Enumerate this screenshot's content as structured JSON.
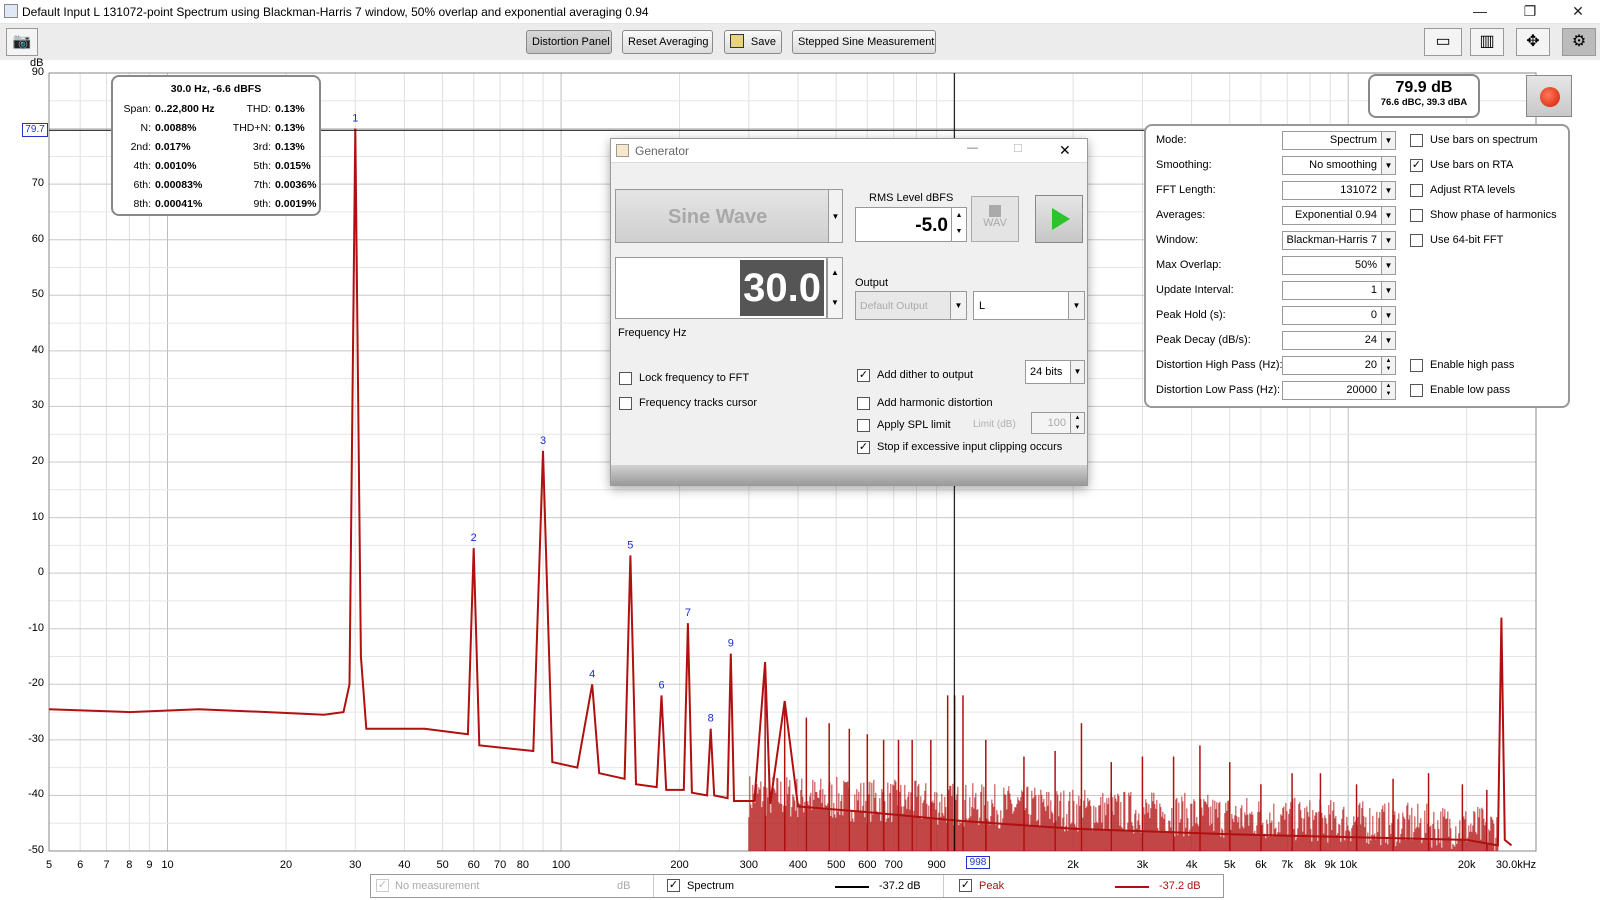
{
  "window": {
    "title": "Default Input L 131072-point Spectrum using Blackman-Harris 7 window, 50% overlap and exponential averaging 0.94"
  },
  "toolbar": {
    "distortion_panel": "Distortion Panel",
    "reset_averaging": "Reset Averaging",
    "save": "Save",
    "stepped_sine": "Stepped Sine Measurement"
  },
  "stats": {
    "header": "30.0 Hz, -6.6 dBFS",
    "rows": [
      [
        "Span:",
        "0..22,800 Hz",
        "THD:",
        "0.13%"
      ],
      [
        "N:",
        "0.0088%",
        "THD+N:",
        "0.13%"
      ],
      [
        "2nd:",
        "0.017%",
        "3rd:",
        "0.13%"
      ],
      [
        "4th:",
        "0.0010%",
        "5th:",
        "0.015%"
      ],
      [
        "6th:",
        "0.00083%",
        "7th:",
        "0.0036%"
      ],
      [
        "8th:",
        "0.00041%",
        "9th:",
        "0.0019%"
      ]
    ]
  },
  "level": {
    "main": "79.9 dB",
    "sub": "76.6 dBC, 39.3 dBA"
  },
  "cursor": {
    "y_label": "79.7",
    "x_label": "998"
  },
  "generator": {
    "title": "Generator",
    "waveform": "Sine Wave",
    "rms_label": "RMS Level dBFS",
    "rms_value": "-5.0",
    "wav_label": "WAV",
    "frequency_value": "30.0",
    "frequency_label": "Frequency Hz",
    "output_label": "Output",
    "output_device": "Default Output",
    "output_channel": "L",
    "lock_frequency": "Lock frequency to FFT",
    "tracks_cursor": "Frequency tracks cursor",
    "add_dither": "Add dither to output",
    "dither_bits": "24 bits",
    "add_harmonic": "Add harmonic distortion",
    "apply_spl": "Apply SPL limit",
    "limit_label": "Limit (dB)",
    "limit_value": "100",
    "stop_clipping": "Stop if excessive input clipping occurs"
  },
  "settings": {
    "rows": [
      {
        "label": "Mode:",
        "value": "Spectrum",
        "kind": "dd"
      },
      {
        "label": "Smoothing:",
        "value": "No  smoothing",
        "kind": "dd"
      },
      {
        "label": "FFT Length:",
        "value": "131072",
        "kind": "dd"
      },
      {
        "label": "Averages:",
        "value": "Exponential 0.94",
        "kind": "dd"
      },
      {
        "label": "Window:",
        "value": "Blackman-Harris 7",
        "kind": "dd"
      },
      {
        "label": "Max Overlap:",
        "value": "50%",
        "kind": "dd"
      },
      {
        "label": "Update Interval:",
        "value": "1",
        "kind": "dd"
      },
      {
        "label": "Peak Hold (s):",
        "value": "0",
        "kind": "dd"
      },
      {
        "label": "Peak Decay (dB/s):",
        "value": "24",
        "kind": "dd"
      },
      {
        "label": "Distortion High Pass (Hz):",
        "value": "20",
        "kind": "spin"
      },
      {
        "label": "Distortion Low Pass (Hz):",
        "value": "20000",
        "kind": "spin"
      }
    ],
    "checks": [
      {
        "label": "Use bars on spectrum",
        "checked": false,
        "row": 0
      },
      {
        "label": "Use bars on RTA",
        "checked": true,
        "row": 1
      },
      {
        "label": "Adjust RTA levels",
        "checked": false,
        "row": 2
      },
      {
        "label": "Show phase of harmonics",
        "checked": false,
        "row": 3
      },
      {
        "label": "Use 64-bit FFT",
        "checked": false,
        "row": 4
      },
      {
        "label": "Enable high pass",
        "checked": false,
        "row": 9
      },
      {
        "label": "Enable low pass",
        "checked": false,
        "row": 10
      }
    ]
  },
  "legend": {
    "no_measurement": "No measurement",
    "db_unit": "dB",
    "spectrum": "Spectrum",
    "spectrum_value": "-37.2 dB",
    "peak": "Peak",
    "peak_value": "-37.2 dB"
  },
  "chart_data": {
    "type": "line",
    "ylabel": "dB",
    "ylim": [
      -50,
      90
    ],
    "xscale": "log",
    "xlim": [
      5,
      30000
    ],
    "y_ticks": [
      "90",
      "70",
      "60",
      "50",
      "40",
      "30",
      "20",
      "10",
      "0",
      "-10",
      "-20",
      "-30",
      "-40",
      "-50"
    ],
    "x_ticks": [
      "5",
      "6",
      "7",
      "8",
      "9",
      "10",
      "20",
      "30",
      "40",
      "50",
      "60",
      "70",
      "80",
      "100",
      "200",
      "300",
      "400",
      "500",
      "600",
      "700",
      "900",
      "2k",
      "3k",
      "4k",
      "5k",
      "6k",
      "7k",
      "8k",
      "9k",
      "10k",
      "20k",
      "30.0kHz"
    ],
    "harmonic_markers": [
      {
        "label": "1",
        "freq": 30,
        "db": 80
      },
      {
        "label": "2",
        "freq": 60,
        "db": 4.5
      },
      {
        "label": "3",
        "freq": 90,
        "db": 22
      },
      {
        "label": "4",
        "freq": 120,
        "db": -20
      },
      {
        "label": "5",
        "freq": 150,
        "db": 3.2
      },
      {
        "label": "6",
        "freq": 180,
        "db": -22
      },
      {
        "label": "7",
        "freq": 210,
        "db": -9
      },
      {
        "label": "8",
        "freq": 240,
        "db": -28
      },
      {
        "label": "9",
        "freq": 270,
        "db": -14.5
      }
    ],
    "series": [
      {
        "name": "Spectrum",
        "color": "#000000"
      },
      {
        "name": "Peak",
        "color": "#b01010"
      }
    ],
    "line_points": [
      [
        5,
        -24.5
      ],
      [
        8,
        -25
      ],
      [
        12,
        -24.5
      ],
      [
        18,
        -25
      ],
      [
        25,
        -25.5
      ],
      [
        28,
        -25
      ],
      [
        29,
        -20
      ],
      [
        30,
        80
      ],
      [
        31,
        -15
      ],
      [
        32,
        -28
      ],
      [
        45,
        -28
      ],
      [
        58,
        -29
      ],
      [
        60,
        4.5
      ],
      [
        62,
        -31
      ],
      [
        85,
        -32
      ],
      [
        90,
        22
      ],
      [
        95,
        -34
      ],
      [
        110,
        -35
      ],
      [
        120,
        -20
      ],
      [
        125,
        -36
      ],
      [
        145,
        -37
      ],
      [
        150,
        3.2
      ],
      [
        155,
        -38
      ],
      [
        175,
        -38.5
      ],
      [
        180,
        -22
      ],
      [
        185,
        -39
      ],
      [
        205,
        -39
      ],
      [
        210,
        -9
      ],
      [
        215,
        -39.5
      ],
      [
        235,
        -40
      ],
      [
        240,
        -28
      ],
      [
        245,
        -40
      ],
      [
        265,
        -40.5
      ],
      [
        270,
        -14.5
      ],
      [
        275,
        -41
      ],
      [
        310,
        -41
      ],
      [
        330,
        -16
      ],
      [
        340,
        -41.5
      ],
      [
        370,
        -23
      ],
      [
        400,
        -42
      ],
      [
        600,
        -43
      ],
      [
        1000,
        -44.5
      ],
      [
        2000,
        -46
      ],
      [
        5000,
        -47
      ],
      [
        10000,
        -47.5
      ],
      [
        20000,
        -48
      ],
      [
        24000,
        -49
      ],
      [
        24500,
        -8
      ],
      [
        25000,
        -48
      ],
      [
        26000,
        -49
      ]
    ],
    "noise_spikes": [
      [
        330,
        -16
      ],
      [
        370,
        -23
      ],
      [
        420,
        -26
      ],
      [
        480,
        -27
      ],
      [
        540,
        -28
      ],
      [
        600,
        -29
      ],
      [
        660,
        -30
      ],
      [
        720,
        -30
      ],
      [
        780,
        -30
      ],
      [
        870,
        -30
      ],
      [
        960,
        -22
      ],
      [
        1000,
        -22
      ],
      [
        1050,
        -22
      ],
      [
        1200,
        -30
      ],
      [
        1500,
        -33
      ],
      [
        1800,
        -32
      ],
      [
        2100,
        -27
      ],
      [
        2500,
        -34
      ],
      [
        3000,
        -33
      ],
      [
        3600,
        -33
      ],
      [
        4200,
        -31
      ],
      [
        5000,
        -34
      ],
      [
        6000,
        -38
      ],
      [
        7200,
        -36
      ],
      [
        8500,
        -36
      ],
      [
        10500,
        -38
      ],
      [
        13000,
        -37
      ],
      [
        16000,
        -36
      ],
      [
        19500,
        -38
      ],
      [
        22500,
        -39
      ]
    ]
  }
}
